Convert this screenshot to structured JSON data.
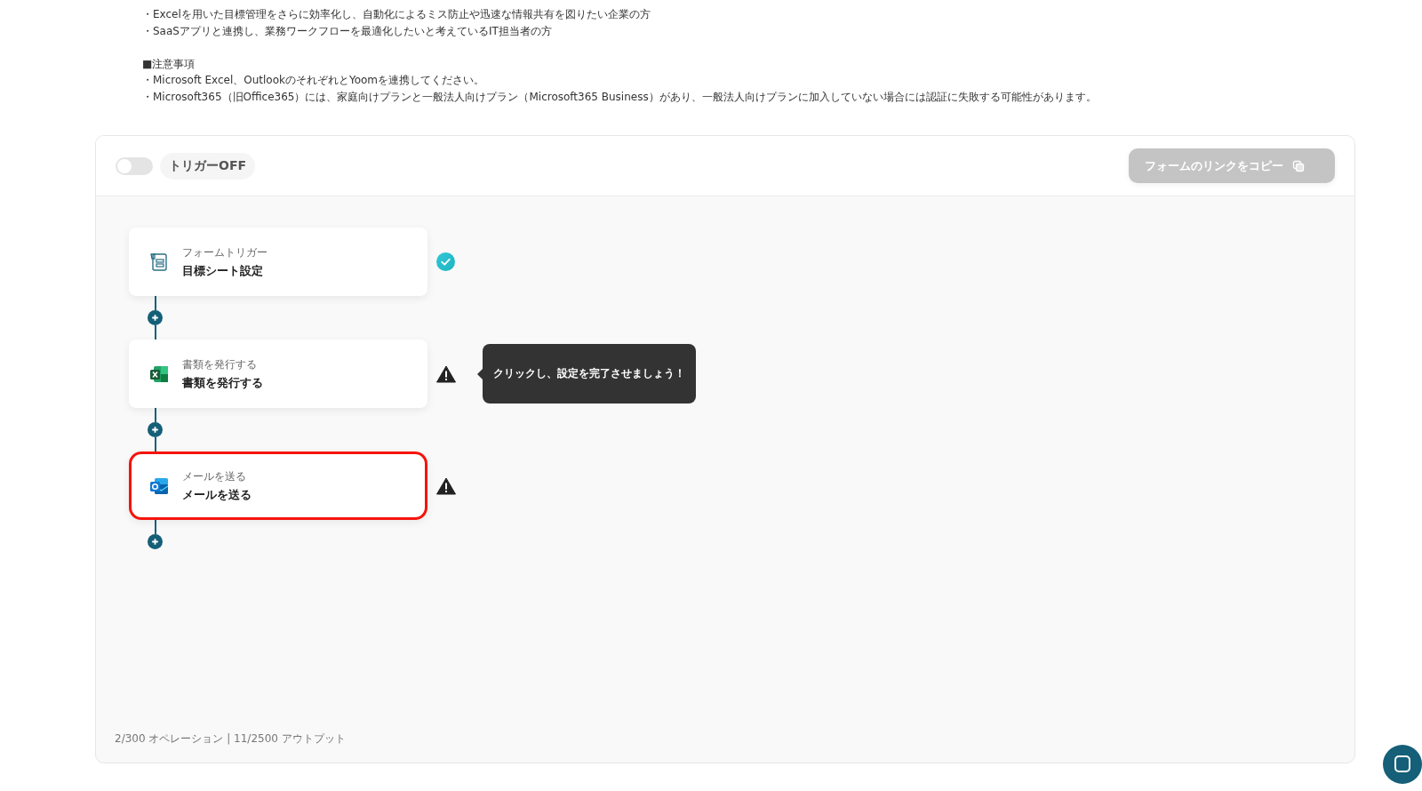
{
  "intro_lines": [
    "・Excelを用いた目標管理をさらに効率化し、自動化によるミス防止や迅速な情報共有を図りたい企業の方",
    "・SaaSアプリと連携し、業務ワークフローを最適化したいと考えているIT担当者の方"
  ],
  "notes": {
    "heading": "■注意事項",
    "lines": [
      "・Microsoft Excel、OutlookのそれぞれとYoomを連携してください。",
      "・Microsoft365（旧Office365）には、家庭向けプランと一般法人向けプラン（Microsoft365 Business）があり、一般法人向けプランに加入していない場合には認証に失敗する可能性があります。"
    ]
  },
  "trigger": {
    "on": false,
    "label": "トリガーOFF"
  },
  "copy_button": {
    "label": "フォームのリンクをコピー",
    "disabled": true
  },
  "steps": [
    {
      "kind": "form",
      "caption": "フォームトリガー",
      "title": "目標シート設定",
      "complete": true,
      "highlighted": false
    },
    {
      "kind": "excel",
      "caption": "書類を発行する",
      "title": "書類を発行する",
      "complete": false,
      "highlighted": false,
      "tooltip": "クリックし、設定を完了させましょう！"
    },
    {
      "kind": "outlook",
      "caption": "メールを送る",
      "title": "メールを送る",
      "complete": false,
      "highlighted": true
    }
  ],
  "usage": "2/300 オペレーション | 11/2500 アウトプット"
}
